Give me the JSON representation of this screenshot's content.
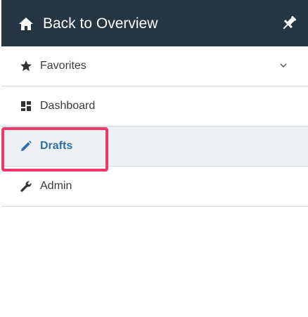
{
  "header": {
    "title": "Back to Overview",
    "home_icon": "home-icon",
    "pin_icon": "pin-icon",
    "background": "#243642"
  },
  "nav": {
    "items": [
      {
        "label": "Favorites",
        "icon": "star-icon",
        "expandable": true,
        "active": false
      },
      {
        "label": "Dashboard",
        "icon": "dashboard-icon",
        "expandable": false,
        "active": false
      },
      {
        "label": "Drafts",
        "icon": "pencil-icon",
        "expandable": false,
        "active": true
      },
      {
        "label": "Admin",
        "icon": "wrench-icon",
        "expandable": false,
        "active": false
      }
    ]
  },
  "colors": {
    "active_text": "#2f6ea6",
    "active_bg": "#eef1f4",
    "highlight": "#f0386b"
  }
}
